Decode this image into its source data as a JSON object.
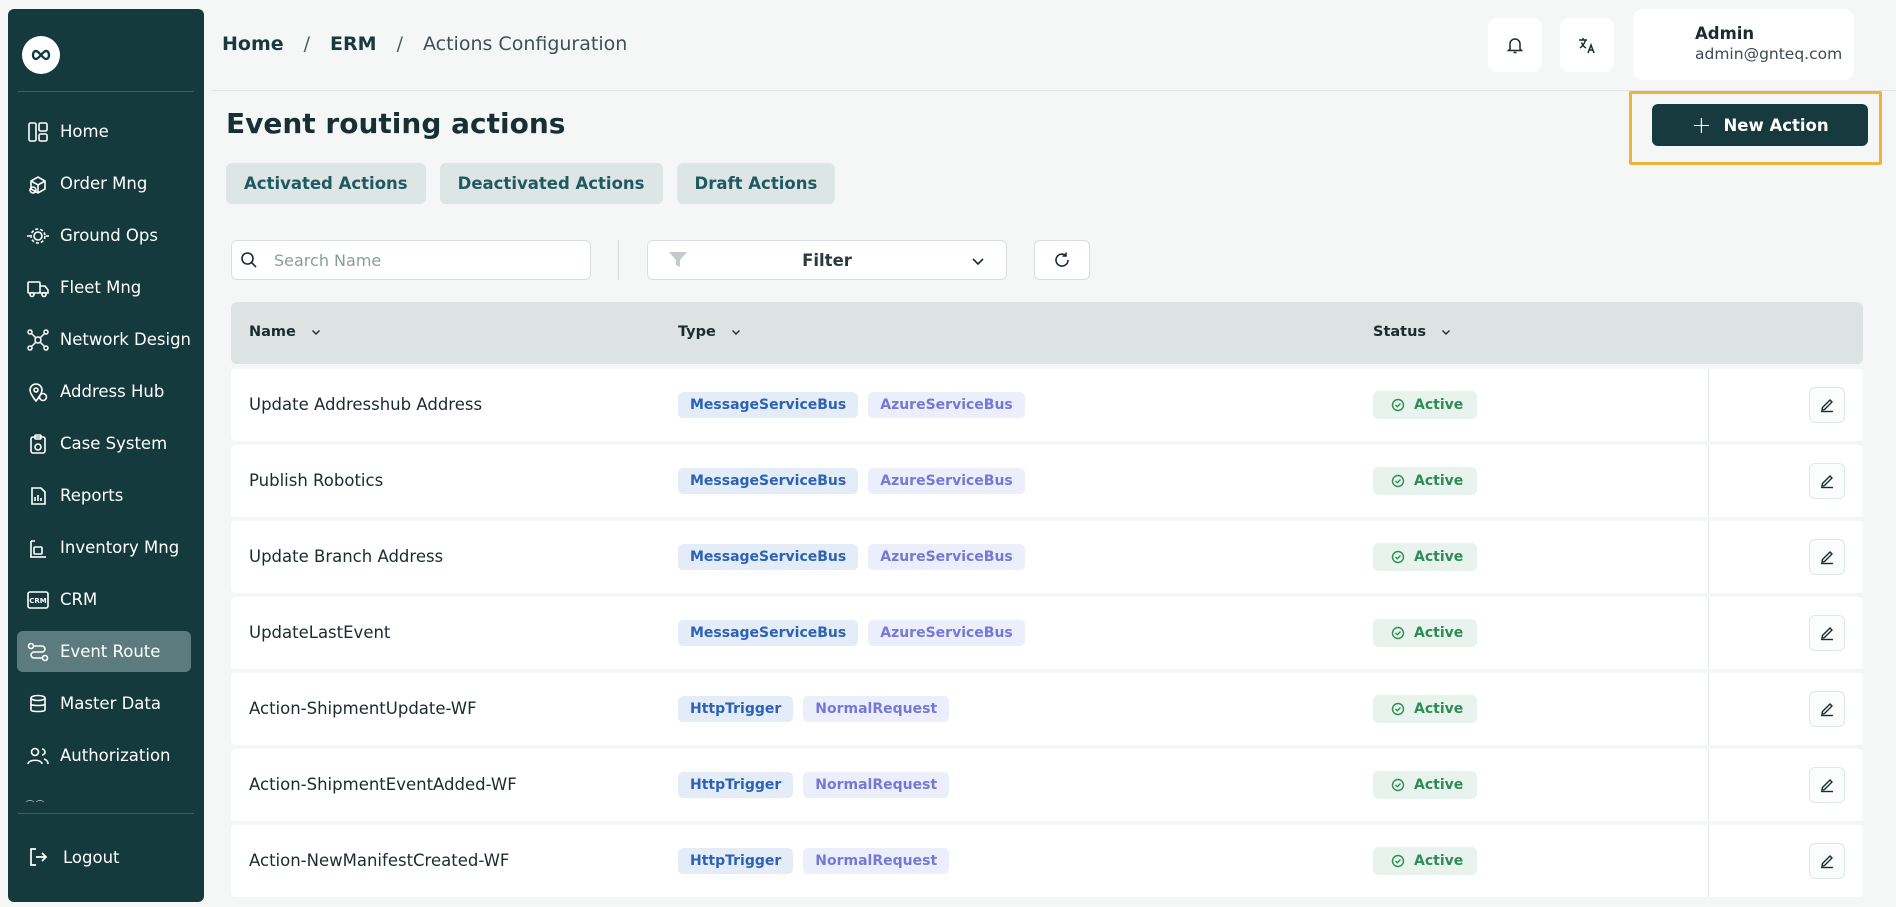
{
  "sidebar": {
    "logo": "infinity-logo",
    "items": [
      {
        "label": "Home",
        "icon": "layout-icon",
        "active": false
      },
      {
        "label": "Order Mng",
        "icon": "box-icon",
        "active": false
      },
      {
        "label": "Ground Ops",
        "icon": "gear-icon",
        "active": false
      },
      {
        "label": "Fleet Mng",
        "icon": "truck-icon",
        "active": false
      },
      {
        "label": "Network Design",
        "icon": "network-icon",
        "active": false
      },
      {
        "label": "Address Hub",
        "icon": "map-pin-icon",
        "active": false
      },
      {
        "label": "Case System",
        "icon": "clipboard-icon",
        "active": false
      },
      {
        "label": "Reports",
        "icon": "report-icon",
        "active": false
      },
      {
        "label": "Inventory Mng",
        "icon": "inventory-icon",
        "active": false
      },
      {
        "label": "CRM",
        "icon": "crm-icon",
        "active": false
      },
      {
        "label": "Event Route",
        "icon": "route-icon",
        "active": true
      },
      {
        "label": "Master Data",
        "icon": "database-icon",
        "active": false
      },
      {
        "label": "Authorization",
        "icon": "users-icon",
        "active": false
      }
    ],
    "logout_label": "Logout"
  },
  "breadcrumb": {
    "home": "Home",
    "section": "ERM",
    "current": "Actions Configuration",
    "separator": "/"
  },
  "header": {
    "notification_icon": "bell-icon",
    "language_icon": "translate-icon",
    "user_name": "Admin",
    "user_email": "admin@gnteq.com"
  },
  "page": {
    "title": "Event routing actions",
    "new_action_label": "New Action"
  },
  "tabs": [
    {
      "label": "Activated Actions"
    },
    {
      "label": "Deactivated Actions"
    },
    {
      "label": "Draft Actions"
    }
  ],
  "toolbar": {
    "search_placeholder": "Search Name",
    "filter_label": "Filter"
  },
  "table": {
    "columns": [
      "Name",
      "Type",
      "Status"
    ],
    "rows": [
      {
        "name": "Update Addresshub Address",
        "type": [
          "MessageServiceBus",
          "AzureServiceBus"
        ],
        "status": "Active"
      },
      {
        "name": "Publish Robotics",
        "type": [
          "MessageServiceBus",
          "AzureServiceBus"
        ],
        "status": "Active"
      },
      {
        "name": "Update Branch Address",
        "type": [
          "MessageServiceBus",
          "AzureServiceBus"
        ],
        "status": "Active"
      },
      {
        "name": "UpdateLastEvent",
        "type": [
          "MessageServiceBus",
          "AzureServiceBus"
        ],
        "status": "Active"
      },
      {
        "name": "Action-ShipmentUpdate-WF",
        "type": [
          "HttpTrigger",
          "NormalRequest"
        ],
        "status": "Active"
      },
      {
        "name": "Action-ShipmentEventAdded-WF",
        "type": [
          "HttpTrigger",
          "NormalRequest"
        ],
        "status": "Active"
      },
      {
        "name": "Action-NewManifestCreated-WF",
        "type": [
          "HttpTrigger",
          "NormalRequest"
        ],
        "status": "Active"
      }
    ]
  },
  "colors": {
    "sidebar_bg": "#153a3e",
    "accent": "#173a3e",
    "highlight": "#f0b23c",
    "status_active": "#2e8b57"
  }
}
